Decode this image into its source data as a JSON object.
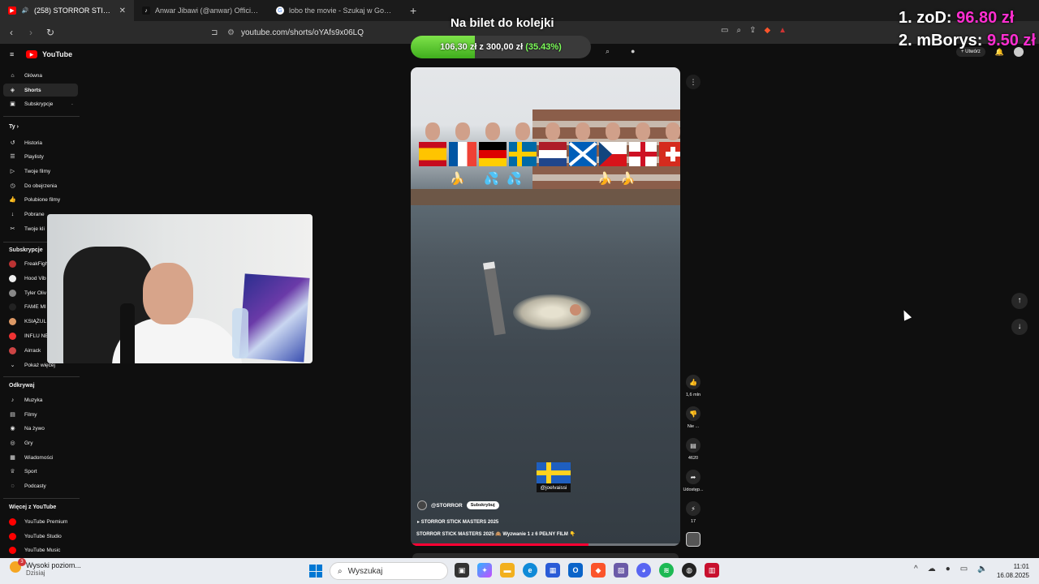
{
  "browser": {
    "tabs": [
      {
        "title": "(258) STORROR STICK MASTE",
        "active": true
      },
      {
        "title": "Anwar Jibawi (@anwar) Official | TikT",
        "active": false
      },
      {
        "title": "lobo the movie - Szukaj w Google",
        "active": false
      }
    ],
    "url": "youtube.com/shorts/oYAfs9x06LQ"
  },
  "overlay": {
    "goal_title": "Na bilet do kolejki",
    "goal_current": "106,30 zł",
    "goal_sep": "z",
    "goal_target": "300,00 zł",
    "goal_percent_label": "(35.43%)",
    "goal_progress": 0.3543,
    "leaderboard": [
      {
        "rank": "1.",
        "name": "zoD:",
        "amount": "96.80 zł"
      },
      {
        "rank": "2.",
        "name": "mBorys:",
        "amount": "9.50 zł"
      }
    ]
  },
  "youtube": {
    "logo": "YouTube",
    "create_label": "Utwórz",
    "sidebar": {
      "main": [
        {
          "label": "Główna",
          "icon": "home-icon"
        },
        {
          "label": "Shorts",
          "icon": "shorts-icon",
          "selected": true
        },
        {
          "label": "Subskrypcje",
          "icon": "subscriptions-icon"
        }
      ],
      "you_header": "Ty",
      "you": [
        {
          "label": "Historia",
          "icon": "history-icon"
        },
        {
          "label": "Playlisty",
          "icon": "playlist-icon"
        },
        {
          "label": "Twoje filmy",
          "icon": "your-videos-icon"
        },
        {
          "label": "Do obejrzenia",
          "icon": "watch-later-icon"
        },
        {
          "label": "Polubione filmy",
          "icon": "liked-icon"
        },
        {
          "label": "Pobrane",
          "icon": "download-icon"
        },
        {
          "label": "Twoje kli",
          "icon": "clips-icon"
        }
      ],
      "subs_header": "Subskrypcje",
      "subs": [
        {
          "label": "FreakFigh",
          "color": "#b33"
        },
        {
          "label": "Hood Vib",
          "color": "#eee"
        },
        {
          "label": "Tyler Oliv",
          "color": "#888"
        },
        {
          "label": "FAME MI",
          "color": "#222"
        },
        {
          "label": "KSIĄŻUL",
          "color": "#d96"
        },
        {
          "label": "INFLU NE",
          "color": "#e33"
        },
        {
          "label": "Airrack",
          "color": "#c44"
        }
      ],
      "show_more": "Pokaż więcej",
      "explore_header": "Odkrywaj",
      "explore": [
        {
          "label": "Muzyka",
          "icon": "music-icon"
        },
        {
          "label": "Filmy",
          "icon": "movies-icon"
        },
        {
          "label": "Na żywo",
          "icon": "live-icon"
        },
        {
          "label": "Gry",
          "icon": "gaming-icon"
        },
        {
          "label": "Wiadomości",
          "icon": "news-icon"
        },
        {
          "label": "Sport",
          "icon": "sport-icon"
        },
        {
          "label": "Podcasty",
          "icon": "podcast-icon"
        }
      ],
      "more_header": "Więcej z YouTube",
      "more": [
        {
          "label": "YouTube Premium"
        },
        {
          "label": "YouTube Studio"
        },
        {
          "label": "YouTube Music"
        }
      ]
    },
    "short": {
      "channel": "@STORROR",
      "subscribe": "Subskrybuj",
      "playlist": "STORROR STICK MASTERS 2025",
      "description": "STORROR STICK MASTERS 2025 🙈 Wyzwanie 1 z 6 PEŁNY FILM 👇",
      "handle_overlay": "@joelvaissi",
      "progress": 0.66,
      "actions": {
        "likes": "1,6 mln",
        "dislike": "Nie ...",
        "comments": "4620",
        "share": "Udostęp...",
        "remix": "17"
      }
    }
  },
  "taskbar": {
    "weather_title": "Wysoki poziom...",
    "weather_sub": "Dzisiaj",
    "weather_badge": "3",
    "search_placeholder": "Wyszukaj",
    "time": "11:01",
    "date": "16.08.2025"
  }
}
